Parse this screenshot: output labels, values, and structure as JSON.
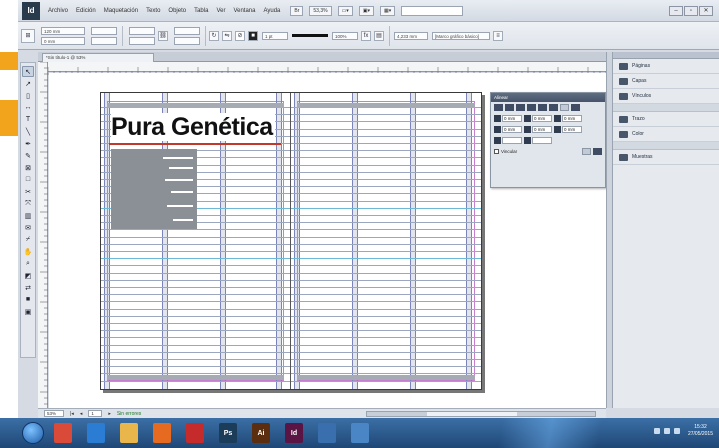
{
  "app": {
    "logo": "Id",
    "menus": [
      "Archivo",
      "Edición",
      "Maquetación",
      "Texto",
      "Objeto",
      "Tabla",
      "Ver",
      "Ventana",
      "Ayuda"
    ],
    "zoom": "53,3%",
    "search_placeholder": "",
    "window_buttons": [
      "–",
      "▫",
      "✕"
    ]
  },
  "control_bar": {
    "field_x": "120 mm",
    "field_y": "0 mm",
    "stroke_weight": "1 pt",
    "percent": "100%",
    "measure": "4,233 mm",
    "frame_option": "[Marco gráfico básico]"
  },
  "document": {
    "tab_title": "*Sin título-1 @ 53%"
  },
  "spread": {
    "headline": "Pura Genética",
    "accent_color": "#c0392b"
  },
  "float_panel": {
    "title": "Alinear",
    "fields": [
      "0 mm",
      "0 mm",
      "0 mm",
      "0 mm",
      "0 mm",
      "0 mm"
    ],
    "checkbox_label": "Vincular"
  },
  "dock": {
    "items": [
      {
        "icon": "pages-icon",
        "label": "Páginas"
      },
      {
        "icon": "layers-icon",
        "label": "Capas"
      },
      {
        "icon": "links-icon",
        "label": "Vínculos"
      },
      {
        "icon": "stroke-icon",
        "label": "Trazo"
      },
      {
        "icon": "color-icon",
        "label": "Color"
      },
      {
        "icon": "swatches-icon",
        "label": "Muestras"
      }
    ]
  },
  "status_bar": {
    "zoom": "53%",
    "page": "1",
    "preflight": "Sin errores"
  },
  "taskbar": {
    "apps": [
      {
        "icon": "chrome-icon",
        "label": "",
        "color": "#d94a38"
      },
      {
        "icon": "ie-icon",
        "label": "",
        "color": "#2b7cd3"
      },
      {
        "icon": "explorer-icon",
        "label": "",
        "color": "#e8b64a"
      },
      {
        "icon": "firefox-icon",
        "label": "",
        "color": "#e66a1f"
      },
      {
        "icon": "opera-icon",
        "label": "",
        "color": "#c62b2b"
      },
      {
        "icon": "photoshop-icon",
        "label": "Ps",
        "color": "#1c3d5a"
      },
      {
        "icon": "illustrator-icon",
        "label": "Ai",
        "color": "#5a2e0f"
      },
      {
        "icon": "indesign-icon",
        "label": "Id",
        "color": "#5b1545"
      },
      {
        "icon": "folder-icon",
        "label": "",
        "color": "#3a6fae"
      },
      {
        "icon": "photos-icon",
        "label": "",
        "color": "#4a86c5"
      }
    ],
    "time": "15:32",
    "date": "27/05/2015"
  }
}
